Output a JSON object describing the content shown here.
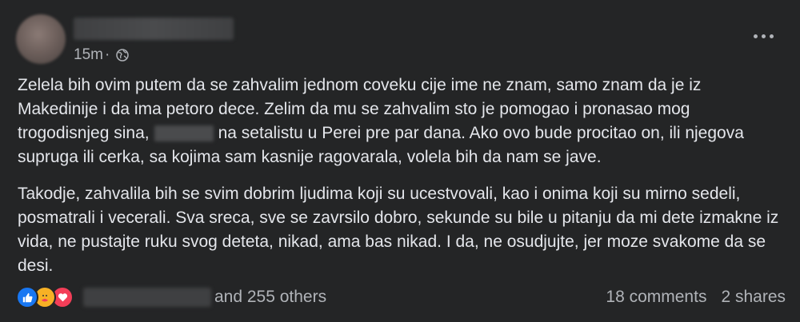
{
  "post": {
    "timestamp": "15m",
    "privacy_icon": "globe-icon",
    "more_icon": "more-horizontal-icon",
    "paragraph1_part1": "Zelela bih ovim putem da se zahvalim jednom coveku cije ime ne znam, samo znam da je iz Makedinije i da ima petoro dece. Zelim da mu se zahvalim sto je pomogao i pronasao mog trogodisnjeg sina,",
    "paragraph1_part2": "na setalistu u Perei pre par dana. Ako ovo bude procitao on, ili njegova supruga ili cerka, sa kojima sam kasnije ragovarala, volela bih da nam se jave.",
    "paragraph2": "Takodje, zahvalila bih se svim dobrim ljudima koji su ucestvovali, kao i onima koji su mirno sedeli, posmatrali i vecerali. Sva sreca, sve se zavrsilo dobro, sekunde su bile u pitanju da mi dete izmakne iz vida, ne pustajte ruku svog deteta, nikad, ama bas nikad. I da, ne osudjujte, jer moze svakome da se desi."
  },
  "footer": {
    "reaction_icons": [
      "like-icon",
      "care-icon",
      "love-icon"
    ],
    "others_text": "and 255 others",
    "comments_text": "18 comments",
    "shares_text": "2 shares"
  },
  "colors": {
    "background": "#242526",
    "text": "#e4e6eb",
    "secondary_text": "#b0b3b8",
    "like": "#1877f2",
    "love": "#f33e58",
    "care": "#f7b125"
  }
}
